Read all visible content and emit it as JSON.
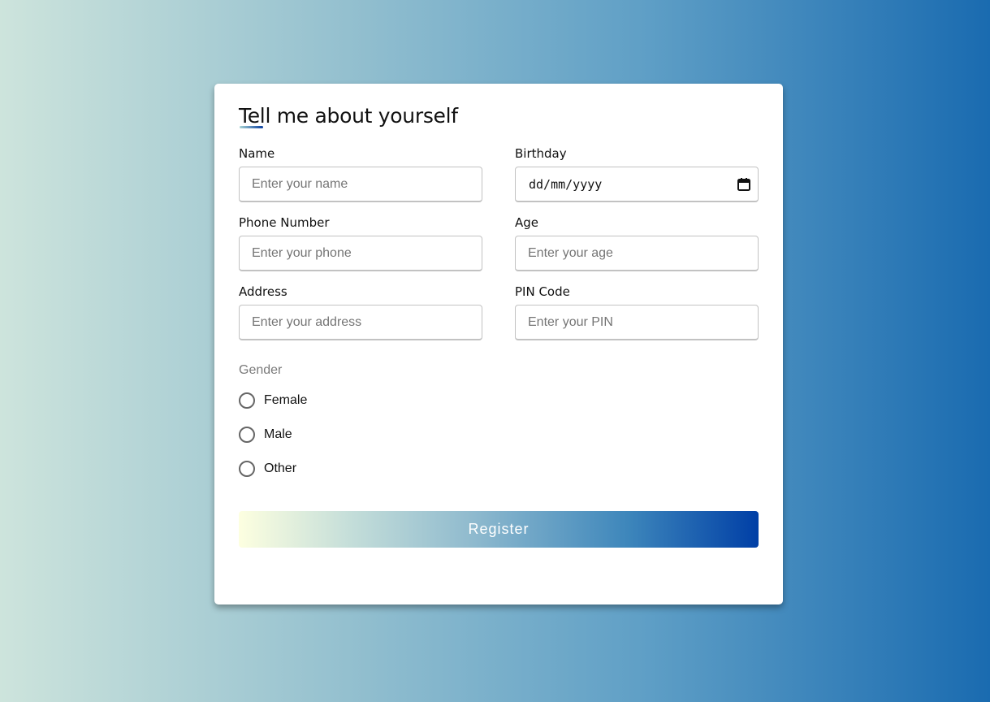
{
  "form": {
    "title": "Tell me about yourself",
    "fields": {
      "name": {
        "label": "Name",
        "placeholder": "Enter your name"
      },
      "birthday": {
        "label": "Birthday",
        "value": "dd/mm/yyyy"
      },
      "phone": {
        "label": "Phone Number",
        "placeholder": "Enter your phone"
      },
      "age": {
        "label": "Age",
        "placeholder": "Enter your age"
      },
      "address": {
        "label": "Address",
        "placeholder": "Enter your address"
      },
      "pin": {
        "label": "PIN Code",
        "placeholder": "Enter your PIN"
      }
    },
    "gender": {
      "label": "Gender",
      "options": [
        "Female",
        "Male",
        "Other"
      ]
    },
    "submit_label": "Register"
  },
  "icons": {
    "birthday": "calendar-icon"
  },
  "colors": {
    "background_start": "#cde4dc",
    "background_end": "#1a6bb0",
    "button_start": "#fdffe0",
    "button_end": "#003fa6"
  }
}
